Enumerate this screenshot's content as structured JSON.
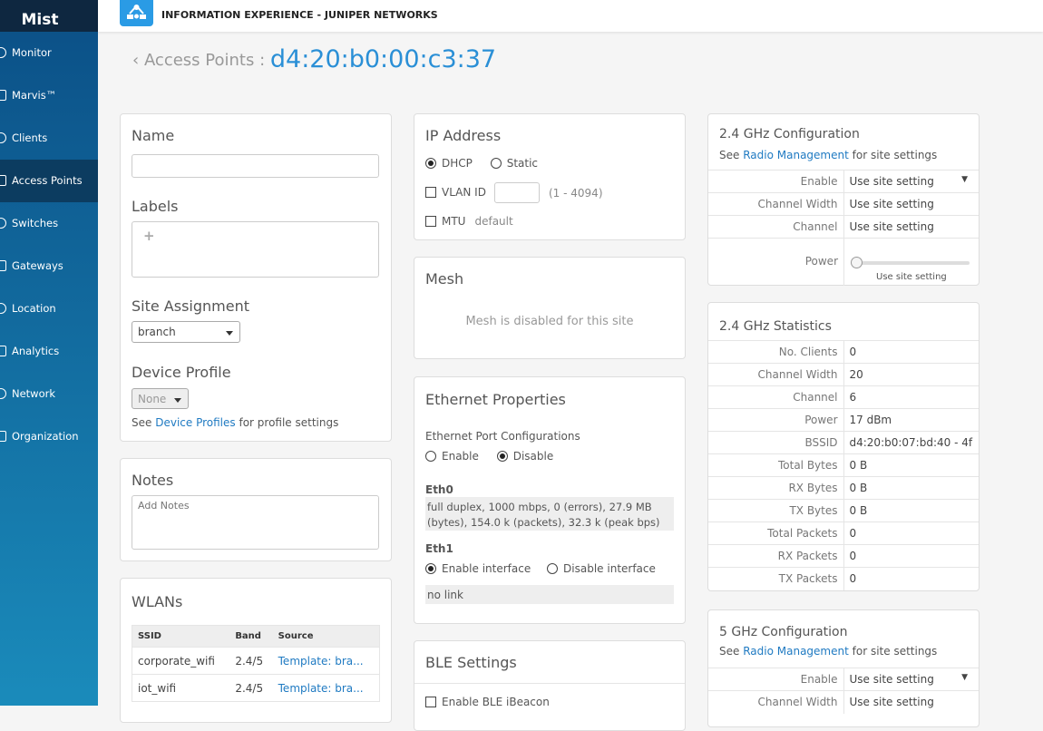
{
  "sidebar": {
    "logo": "Mist",
    "items": [
      {
        "label": "Monitor"
      },
      {
        "label": "Marvis™"
      },
      {
        "label": "Clients"
      },
      {
        "label": "Access Points"
      },
      {
        "label": "Switches"
      },
      {
        "label": "Gateways"
      },
      {
        "label": "Location"
      },
      {
        "label": "Analytics"
      },
      {
        "label": "Network"
      },
      {
        "label": "Organization"
      }
    ]
  },
  "header": {
    "title": "INFORMATION EXPERIENCE - JUNIPER NETWORKS"
  },
  "breadcrumb": {
    "parent": "Access Points :",
    "device": "d4:20:b0:00:c3:37"
  },
  "info": {
    "name_label": "Name",
    "name_value": "",
    "labels_label": "Labels",
    "add": "+",
    "site_label": "Site Assignment",
    "site_value": "branch",
    "profile_label": "Device Profile",
    "profile_value": "None",
    "see": "See",
    "profile_link": "Device Profiles",
    "profile_suffix": "for profile settings"
  },
  "notes": {
    "title": "Notes",
    "placeholder": "Add Notes"
  },
  "wlans": {
    "title": "WLANs",
    "headers": [
      "SSID",
      "Band",
      "Source"
    ],
    "rows": [
      [
        "corporate_wifi",
        "2.4/5",
        "Template: bra..."
      ],
      [
        "iot_wifi",
        "2.4/5",
        "Template: bra..."
      ]
    ]
  },
  "ip": {
    "title": "IP Address",
    "dhcp": "DHCP",
    "static": "Static",
    "vlan": "VLAN ID",
    "vlan_value": "",
    "vlan_range": "(1 - 4094)",
    "mtu": "MTU",
    "mtu_value": "default"
  },
  "mesh": {
    "title": "Mesh",
    "message": "Mesh is disabled for this site"
  },
  "ethernet": {
    "title": "Ethernet Properties",
    "port_conf": "Ethernet Port Configurations",
    "enable": "Enable",
    "disable": "Disable",
    "eth0": "Eth0",
    "eth0_status": "full duplex, 1000 mbps, 0 (errors), 27.9 MB (bytes), 154.0 k (packets), 32.3 k (peak bps)",
    "eth1": "Eth1",
    "enable_if": "Enable interface",
    "disable_if": "Disable interface",
    "eth1_status": "no link"
  },
  "ble": {
    "title": "BLE Settings",
    "ibeacon": "Enable BLE iBeacon"
  },
  "cfg24": {
    "title": "2.4 GHz Configuration",
    "see": "See",
    "link": "Radio Management",
    "suffix": "for site settings",
    "rows": [
      [
        "Enable",
        "Use site setting"
      ],
      [
        "Channel Width",
        "Use site setting"
      ],
      [
        "Channel",
        "Use site setting"
      ]
    ],
    "power": "Power",
    "power_caption": "Use site setting",
    "power_level": 0
  },
  "stats24": {
    "title": "2.4 GHz Statistics",
    "rows": [
      [
        "No. Clients",
        "0"
      ],
      [
        "Channel Width",
        "20"
      ],
      [
        "Channel",
        "6"
      ],
      [
        "Power",
        "17 dBm"
      ],
      [
        "BSSID",
        "d4:20:b0:07:bd:40 - 4f"
      ],
      [
        "Total Bytes",
        "0 B"
      ],
      [
        "RX Bytes",
        "0 B"
      ],
      [
        "TX Bytes",
        "0 B"
      ],
      [
        "Total Packets",
        "0"
      ],
      [
        "RX Packets",
        "0"
      ],
      [
        "TX Packets",
        "0"
      ]
    ]
  },
  "cfg5": {
    "title": "5 GHz Configuration",
    "see": "See",
    "link": "Radio Management",
    "suffix": "for site settings",
    "rows": [
      [
        "Enable",
        "Use site setting"
      ],
      [
        "Channel Width",
        "Use site setting"
      ]
    ]
  }
}
